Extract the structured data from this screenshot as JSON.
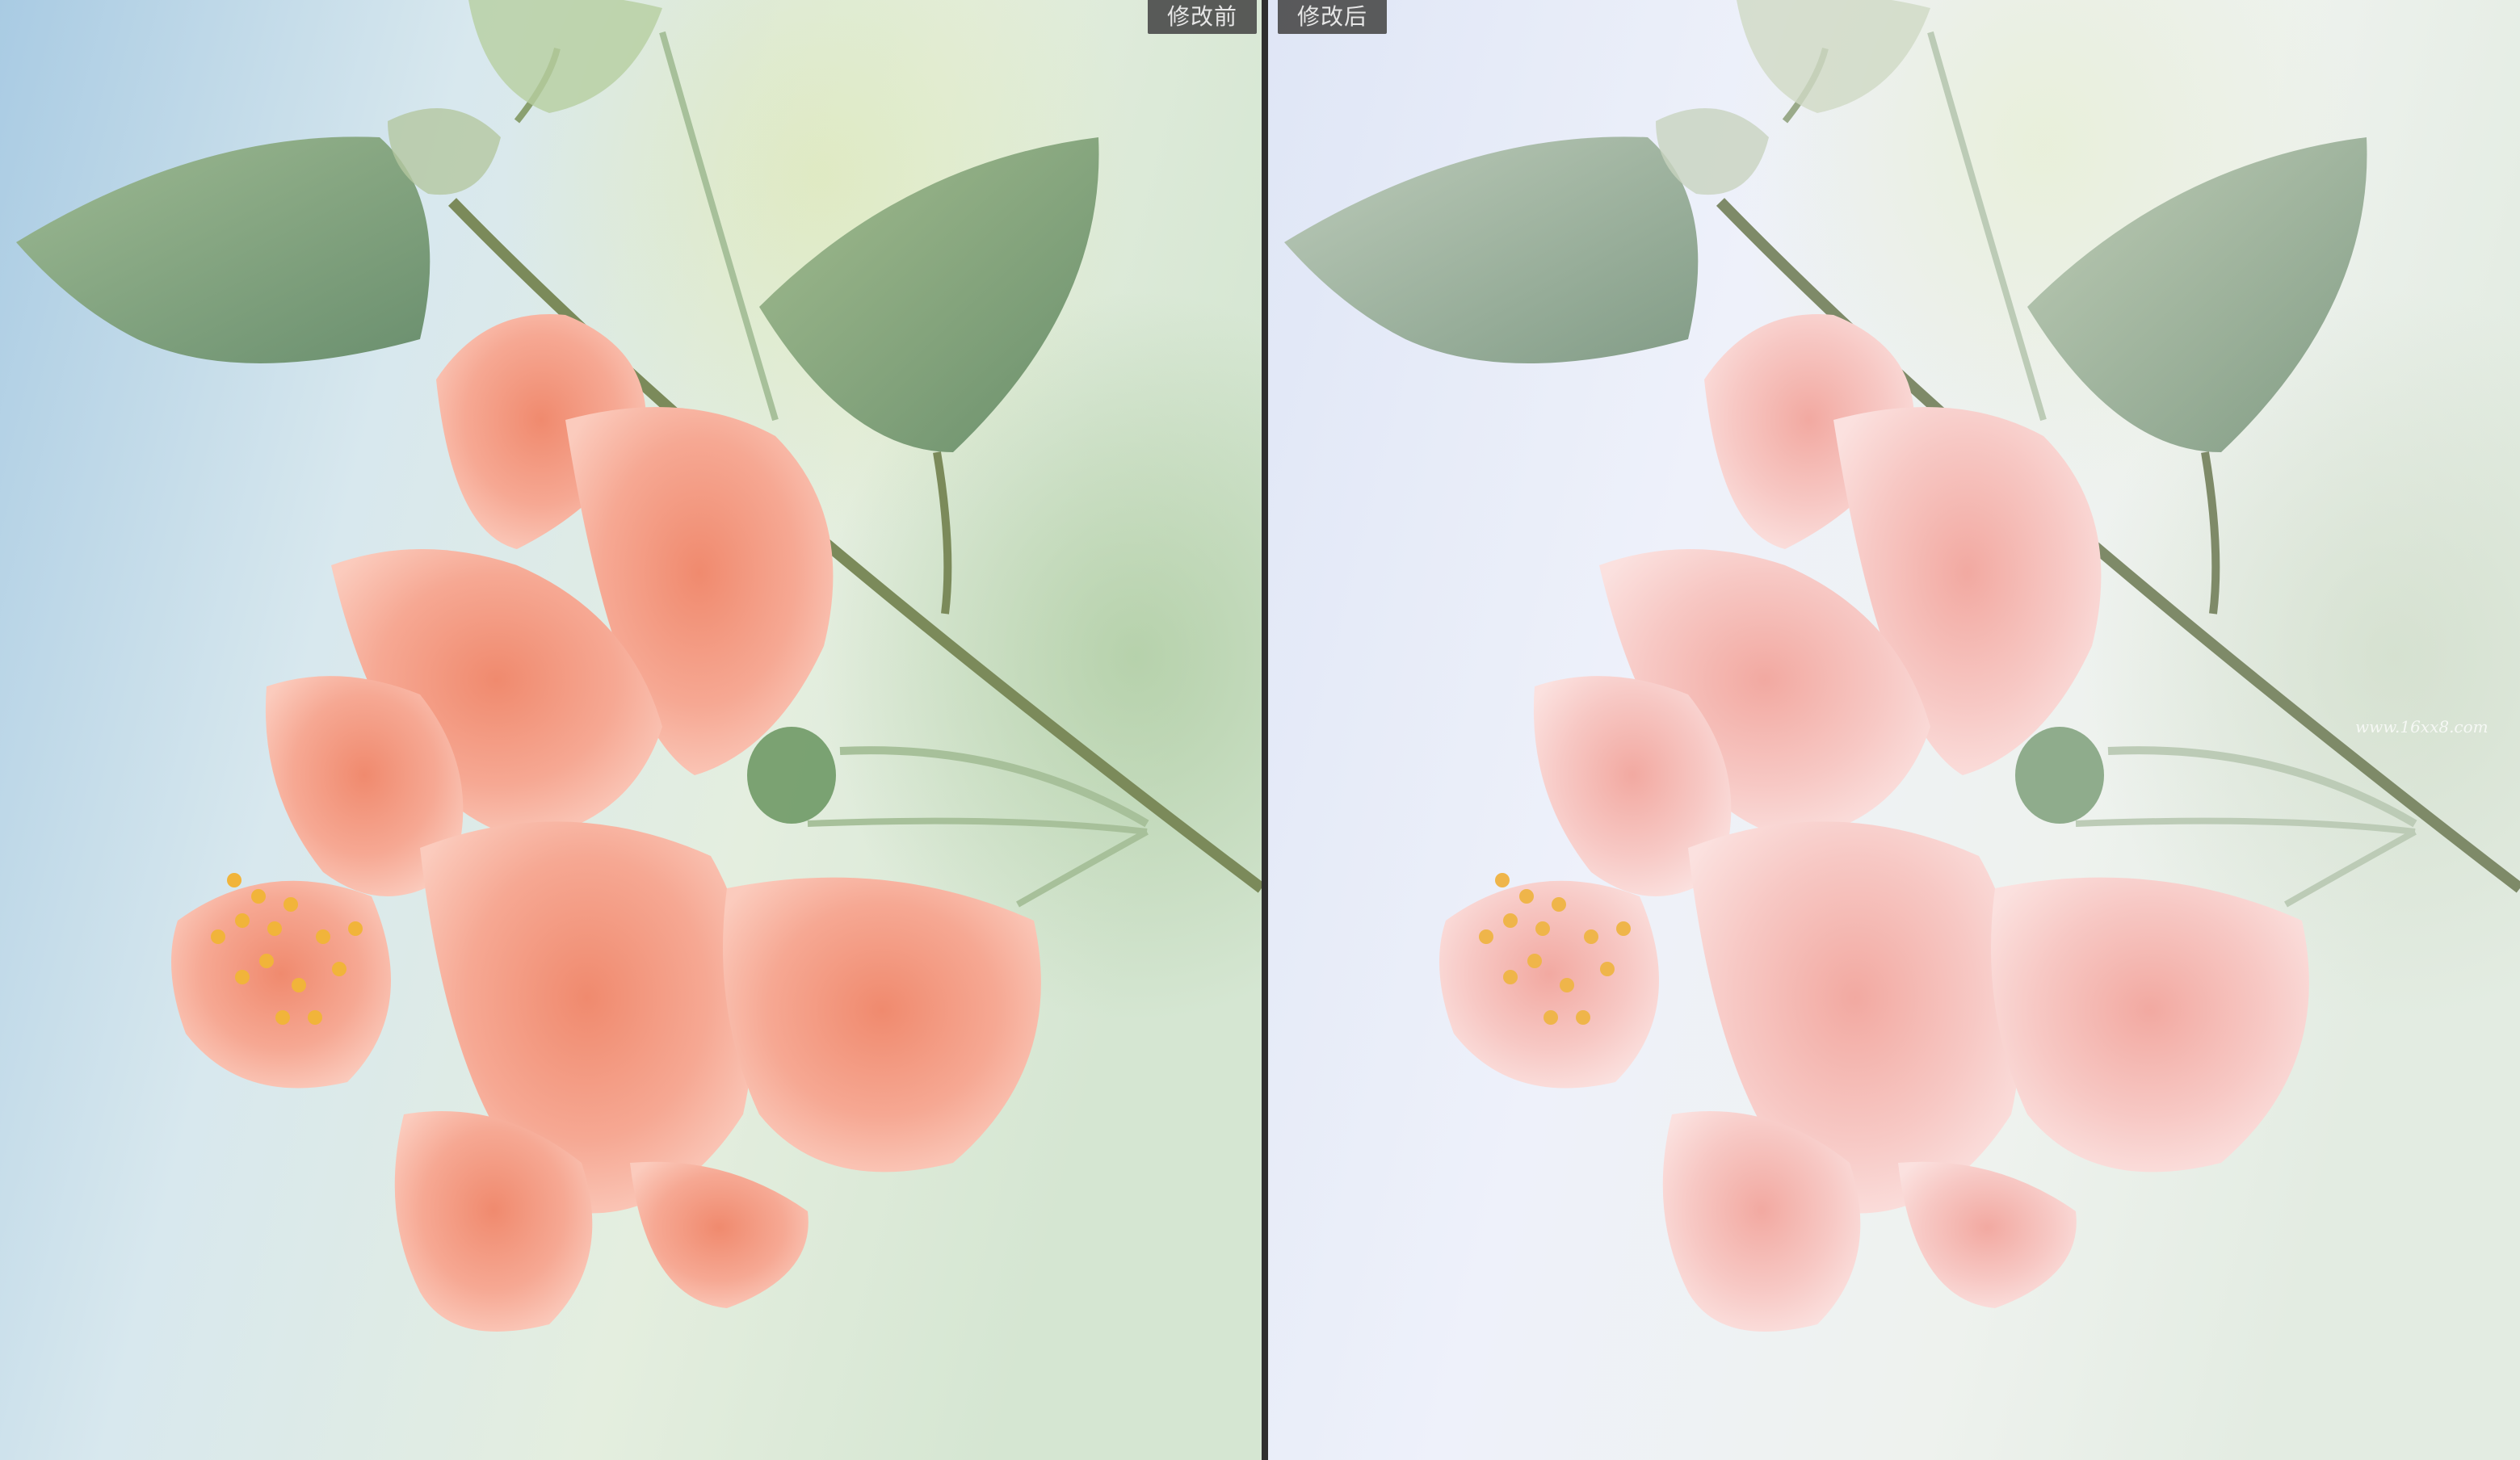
{
  "comparison": {
    "before_label": "修改前",
    "after_label": "修改后"
  },
  "photo": {
    "subject": "pink-hibiscus-flower",
    "watermark": "www.16xx8.com"
  },
  "colors": {
    "before_petal": "#f4a58f",
    "after_petal": "#f6c6c3",
    "before_bg": "#cfe2ea",
    "after_bg": "#e9eef8",
    "leaf": "#8aa878"
  }
}
